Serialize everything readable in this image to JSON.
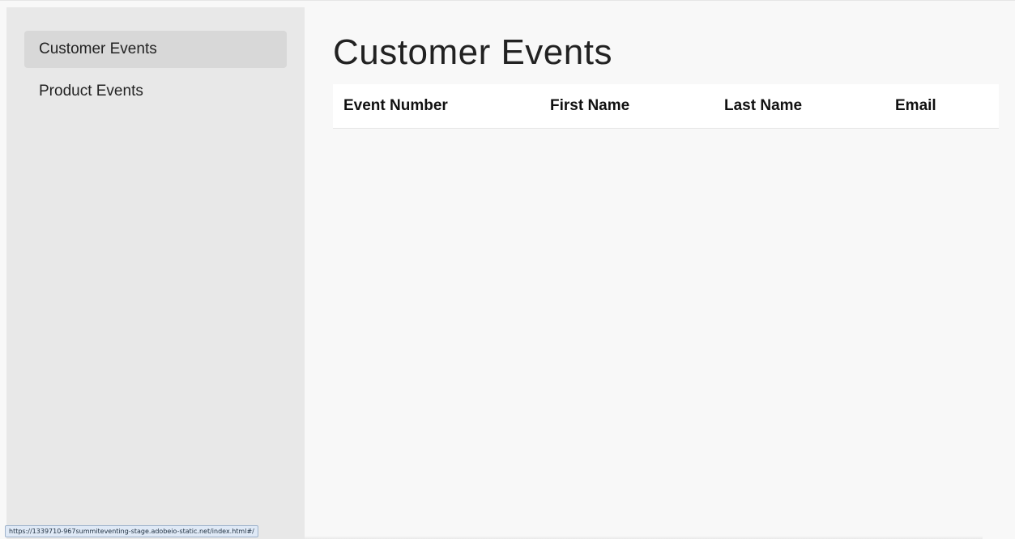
{
  "sidebar": {
    "items": [
      {
        "label": "Customer Events",
        "selected": true
      },
      {
        "label": "Product Events",
        "selected": false
      }
    ]
  },
  "main": {
    "title": "Customer Events",
    "table": {
      "columns": [
        "Event Number",
        "First Name",
        "Last Name",
        "Email"
      ],
      "rows": []
    }
  },
  "status_bar": {
    "url": "https://1339710-967summiteventing-stage.adobeio-static.net/index.html#/"
  },
  "colors": {
    "sidebar_bg": "#e8e8e8",
    "selected_item_bg": "#d8d8d8",
    "main_bg": "#f8f8f8",
    "table_header_bg": "#ffffff"
  }
}
